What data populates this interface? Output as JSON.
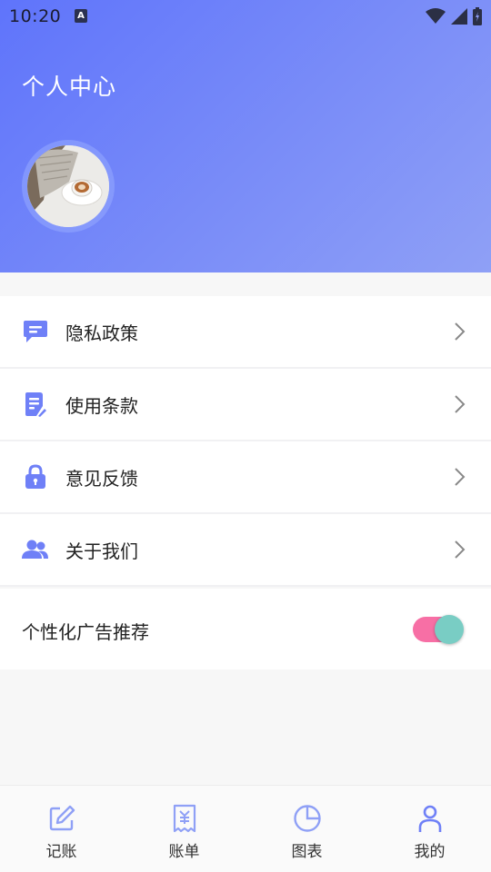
{
  "status_bar": {
    "time": "10:20",
    "app_icon_letter": "A"
  },
  "header": {
    "title": "个人中心"
  },
  "menu": {
    "items": [
      {
        "label": "隐私政策",
        "icon": "message-icon"
      },
      {
        "label": "使用条款",
        "icon": "document-icon"
      },
      {
        "label": "意见反馈",
        "icon": "lock-icon"
      },
      {
        "label": "关于我们",
        "icon": "users-icon"
      }
    ]
  },
  "ad_setting": {
    "label": "个性化广告推荐",
    "enabled": true
  },
  "tabbar": {
    "tabs": [
      {
        "label": "记账",
        "icon": "edit-icon"
      },
      {
        "label": "账单",
        "icon": "receipt-icon"
      },
      {
        "label": "图表",
        "icon": "pie-chart-icon"
      },
      {
        "label": "我的",
        "icon": "person-icon",
        "active": true
      }
    ]
  },
  "colors": {
    "accent": "#6f80f7",
    "header_start": "#5f74fb",
    "header_end": "#8fa0f6",
    "toggle_track": "#f76fa5",
    "toggle_thumb": "#79cdc4"
  }
}
